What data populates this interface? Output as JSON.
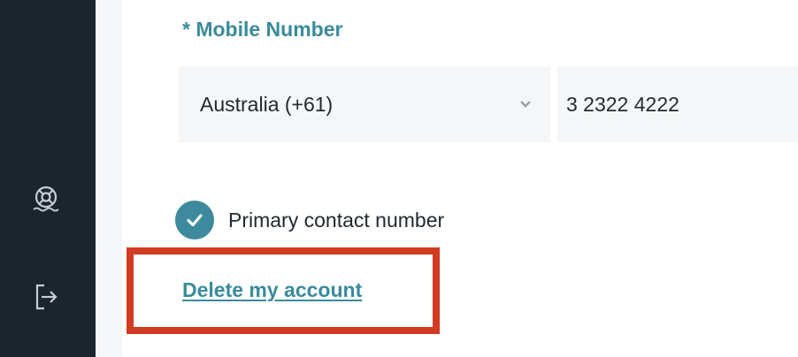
{
  "sidebar": {
    "items": [
      {
        "icon": "lifebuoy-icon"
      },
      {
        "icon": "logout-icon"
      }
    ]
  },
  "mobile": {
    "label": "* Mobile Number",
    "country": "Australia (+61)",
    "number": "3 2322 4222",
    "primary_checked": true,
    "primary_label": "Primary contact number"
  },
  "account": {
    "delete_label": "Delete my account"
  },
  "colors": {
    "sidebar": "#1b252e",
    "accent": "#3a8b9c",
    "highlight": "#d33a22",
    "field_bg": "#f5f6f8"
  }
}
